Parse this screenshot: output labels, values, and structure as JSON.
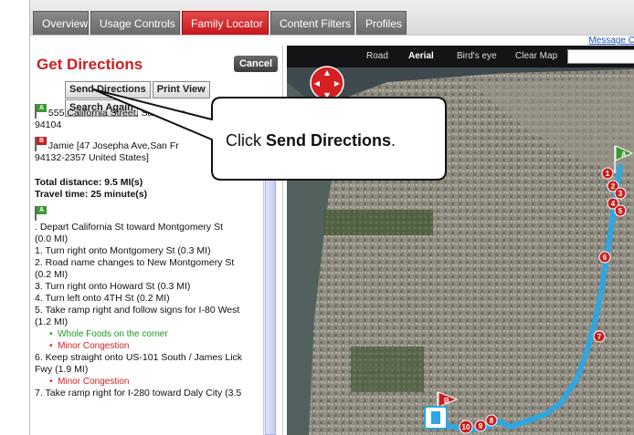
{
  "tabs": [
    {
      "label": "Overview",
      "active": false
    },
    {
      "label": "Usage Controls",
      "active": false
    },
    {
      "label": "Family Locator",
      "active": true
    },
    {
      "label": "Content Filters",
      "active": false
    },
    {
      "label": "Profiles",
      "active": false
    }
  ],
  "message_link": "Message C",
  "panel": {
    "title": "Get Directions",
    "cancel_label": "Cancel",
    "buttons": {
      "send": "Send Directions",
      "print": "Print View",
      "search_again": "Search Again"
    },
    "start_flag": "A",
    "end_flag": "B",
    "start_line1": "555 California Street, San Franc",
    "start_line2": "94104",
    "end_line1": "Jamie [47 Josepha Ave,San Fr",
    "end_line2": "94132-2357 United States]",
    "total_distance": "Total distance: 9.5 MI(s)",
    "travel_time": "Travel time: 25 minute(s)",
    "depart_line1": ". Depart California St toward Montgomery St",
    "depart_line2": "(0.0 MI)",
    "steps": [
      "1. Turn right onto Montgomery St (0.3 MI)",
      "2. Road name changes to New Montgomery St",
      "(0.2 MI)",
      "3. Turn right onto Howard St (0.3 MI)",
      "4. Turn left onto 4TH St (0.2 MI)",
      "5. Take ramp right and follow signs for I-80 West",
      "(1.2 MI)"
    ],
    "note_whole_foods": "Whole Foods on the corner",
    "note_congestion": "Minor Congestion",
    "step6_line1": "6. Keep straight onto US-101 South / James Lick",
    "step6_line2": "Fwy (1.9 MI)",
    "note_congestion_2": "Minor Congestion",
    "step7_line1": "7. Take ramp right for I-280 toward Daly City (3.5"
  },
  "map": {
    "views": [
      "Road",
      "Aerial",
      "Bird's eye",
      "Clear Map"
    ],
    "selected_view": "Aerial",
    "start_label": "A",
    "end_label": "B",
    "waypoints": [
      "1",
      "2",
      "3",
      "4",
      "5",
      "6",
      "7",
      "8",
      "9",
      "10"
    ]
  },
  "callout": {
    "prefix": "Click ",
    "bold": "Send Directions",
    "suffix": "."
  },
  "colors": {
    "brand_red": "#c8161b",
    "route_blue": "#2fa6e0",
    "start_flag": "#3a9a2f",
    "end_flag": "#c81e1e"
  }
}
